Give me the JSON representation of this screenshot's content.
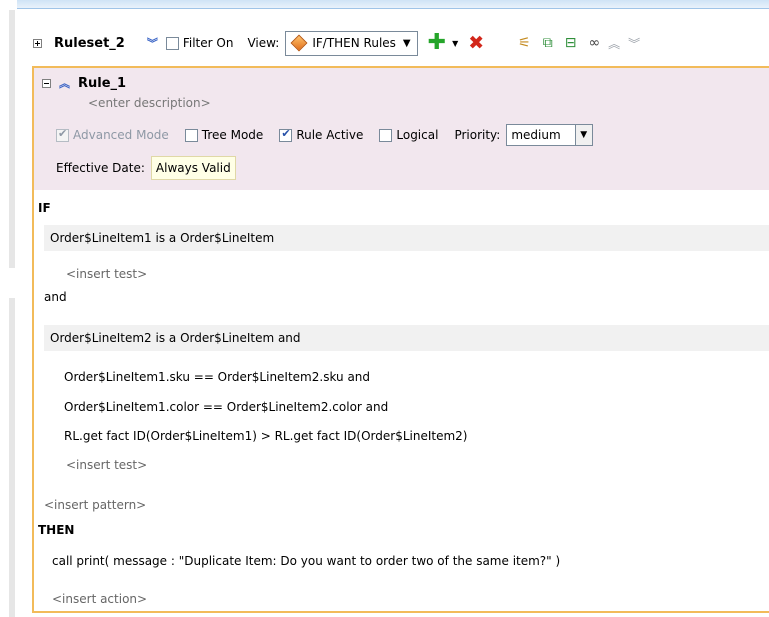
{
  "ruleset": {
    "name": "Ruleset_2",
    "filter_label": "Filter On",
    "view_label": "View:",
    "view_value": "IF/THEN Rules"
  },
  "icons": {
    "add": "add-rule-icon",
    "delete": "delete-rule-icon",
    "tree": "tree-structure-icon",
    "copy": "copy-icon",
    "paste": "paste-icon",
    "view": "glasses-icon",
    "move_up": "chevron-up-icon",
    "move_down": "chevron-down-icon"
  },
  "rule": {
    "name": "Rule_1",
    "description_placeholder": "<enter description>",
    "advanced_mode_label": "Advanced Mode",
    "tree_mode_label": "Tree Mode",
    "rule_active_label": "Rule Active",
    "logical_label": "Logical",
    "priority_label": "Priority:",
    "priority_value": "medium",
    "effective_date_label": "Effective Date:",
    "effective_date_value": "Always Valid"
  },
  "if_section": {
    "keyword": "IF",
    "pattern1": "Order$LineItem1 is a Order$LineItem",
    "insert_test": "<insert test>",
    "and_keyword": "and",
    "pattern2": "Order$LineItem2 is a Order$LineItem  and",
    "tests": [
      "Order$LineItem1.sku  ==  Order$LineItem2.sku and",
      "Order$LineItem1.color  ==  Order$LineItem2.color and",
      "RL.get fact ID(Order$LineItem1)  >  RL.get fact ID(Order$LineItem2)"
    ],
    "insert_test_2": "<insert test>",
    "insert_pattern": "<insert pattern>"
  },
  "then_section": {
    "keyword": "THEN",
    "action": "call print( message : \"Duplicate Item: Do you want to order two of the same item?\" )",
    "insert_action": "<insert action>"
  },
  "colors": {
    "panel_border": "#f2bb5a",
    "header_bg": "#f2e7ee",
    "pattern_band": "#f1f1f1",
    "effective_date_bg": "#ffffe6"
  }
}
